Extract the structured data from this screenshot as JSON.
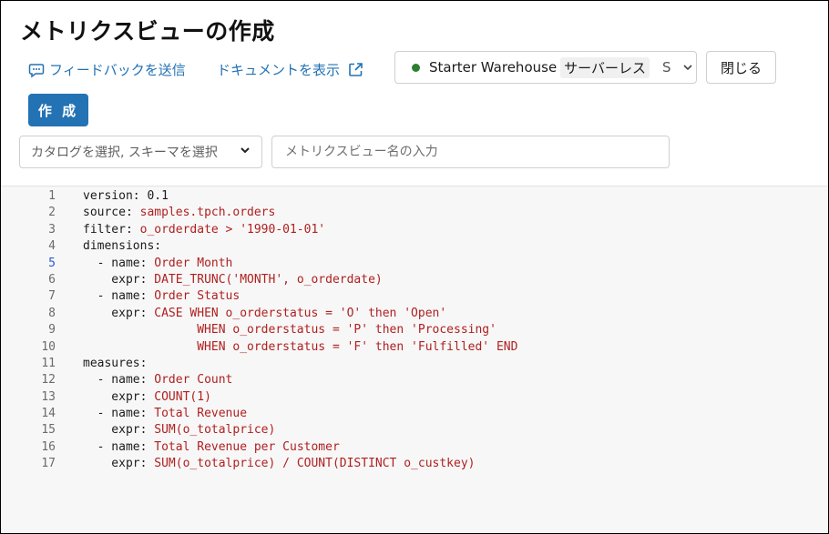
{
  "page": {
    "title": "メトリクスビューの作成",
    "feedback_link": "フィードバックを送信",
    "docs_link": "ドキュメントを表示",
    "warehouse": {
      "name": "Starter Warehouse",
      "tag": "サーバーレス",
      "size": "S",
      "status_color": "#2e7d32"
    },
    "close_label": "閉じる",
    "create_label": "作 成",
    "catalog_select_label": "カタログを選択, スキーマを選択",
    "name_placeholder": "メトリクスビュー名の入力"
  },
  "editor": {
    "active_line": 5,
    "lines": [
      {
        "n": "1",
        "key": "version: ",
        "val": "0.1",
        "keycolor": "plain"
      },
      {
        "n": "2",
        "key": "source: ",
        "val": "samples.tpch.orders"
      },
      {
        "n": "3",
        "key": "filter: ",
        "val": "o_orderdate > '1990-01-01'"
      },
      {
        "n": "4",
        "key": "dimensions:",
        "val": ""
      },
      {
        "n": "5",
        "key": "  - name: ",
        "val": "Order Month"
      },
      {
        "n": "6",
        "key": "    expr: ",
        "val": "DATE_TRUNC('MONTH', o_orderdate)"
      },
      {
        "n": "7",
        "key": "  - name: ",
        "val": "Order Status"
      },
      {
        "n": "8",
        "key": "    expr: ",
        "val": "CASE WHEN o_orderstatus = 'O' then 'Open'"
      },
      {
        "n": "9",
        "key": "                ",
        "val": "WHEN o_orderstatus = 'P' then 'Processing'"
      },
      {
        "n": "10",
        "key": "                ",
        "val": "WHEN o_orderstatus = 'F' then 'Fulfilled' END"
      },
      {
        "n": "11",
        "key": "measures:",
        "val": ""
      },
      {
        "n": "12",
        "key": "  - name: ",
        "val": "Order Count"
      },
      {
        "n": "13",
        "key": "    expr: ",
        "val": "COUNT(1)"
      },
      {
        "n": "14",
        "key": "  - name: ",
        "val": "Total Revenue"
      },
      {
        "n": "15",
        "key": "    expr: ",
        "val": "SUM(o_totalprice)"
      },
      {
        "n": "16",
        "key": "  - name: ",
        "val": "Total Revenue per Customer"
      },
      {
        "n": "17",
        "key": "    expr: ",
        "val": "SUM(o_totalprice) / COUNT(DISTINCT o_custkey)"
      }
    ]
  }
}
